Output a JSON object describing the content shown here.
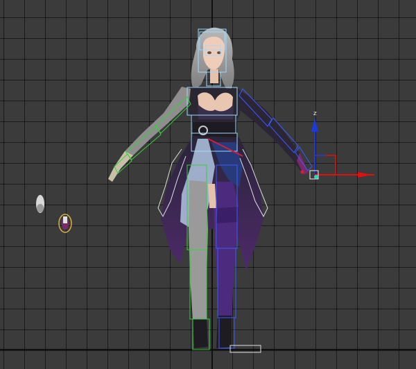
{
  "viewport": {
    "name": "perspective-viewport",
    "grid": true
  },
  "gizmo": {
    "z_label": "z",
    "x_axis_color": "#e01010",
    "y_axis_color": "#10c010",
    "z_axis_color": "#1a3ae0"
  },
  "colors": {
    "background": "#3b3b3b",
    "grid_line": "#1a1a1a",
    "bone_green": "#2ecc2e",
    "bone_blue": "#3a5cff",
    "bone_white": "#e0e0e0",
    "bone_cyan": "#7fd8ff"
  }
}
